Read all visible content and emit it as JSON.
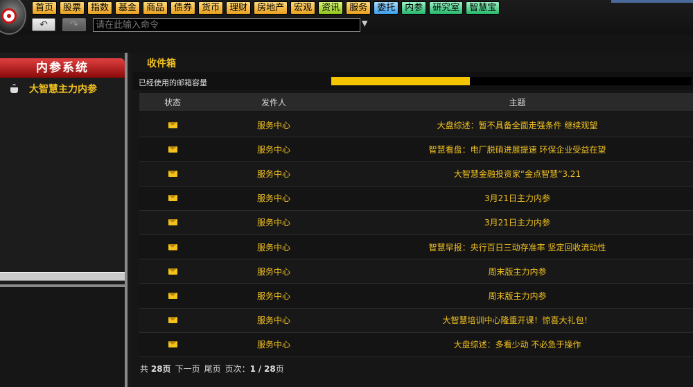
{
  "toolbar": {
    "nav": [
      {
        "label": "首页",
        "style": "orange"
      },
      {
        "label": "股票",
        "style": "orange"
      },
      {
        "label": "指数",
        "style": "orange"
      },
      {
        "label": "基金",
        "style": "orange"
      },
      {
        "label": "商品",
        "style": "orange"
      },
      {
        "label": "债券",
        "style": "orange"
      },
      {
        "label": "货币",
        "style": "orange"
      },
      {
        "label": "理财",
        "style": "orange"
      },
      {
        "label": "房地产",
        "style": "orange"
      },
      {
        "label": "宏观",
        "style": "orange"
      },
      {
        "label": "资讯",
        "style": "green"
      },
      {
        "label": "服务",
        "style": "orange"
      },
      {
        "label": "委托",
        "style": "blue"
      },
      {
        "label": "内参",
        "style": "teal"
      },
      {
        "label": "研究室",
        "style": "teal"
      },
      {
        "label": "智慧宝",
        "style": "teal"
      }
    ],
    "command_placeholder": "请在此输入命令"
  },
  "sidebar": {
    "header": "内参系统",
    "items": [
      {
        "label": "大智慧主力内参",
        "icon": "coffee-cup-icon"
      }
    ]
  },
  "main": {
    "title": "收件箱",
    "quota_label": "已经使用的邮箱容量",
    "quota_used_fraction": 0.385,
    "columns": {
      "status": "状态",
      "sender": "发件人",
      "subject": "主题"
    },
    "messages": [
      {
        "sender": "服务中心",
        "subject": "大盘综述：暂不具备全面走强条件 继续观望"
      },
      {
        "sender": "服务中心",
        "subject": "智慧看盘：电厂脱硝进展提速 环保企业受益在望"
      },
      {
        "sender": "服务中心",
        "subject": "大智慧金融投资家“金点智慧”3.21"
      },
      {
        "sender": "服务中心",
        "subject": "3月21日主力内参"
      },
      {
        "sender": "服务中心",
        "subject": "3月21日主力内参"
      },
      {
        "sender": "服务中心",
        "subject": "智慧早报：央行百日三动存准率 坚定回收流动性"
      },
      {
        "sender": "服务中心",
        "subject": "周末版主力内参"
      },
      {
        "sender": "服务中心",
        "subject": "周末版主力内参"
      },
      {
        "sender": "服务中心",
        "subject": "大智慧培训中心隆重开课！惊喜大礼包！"
      },
      {
        "sender": "服务中心",
        "subject": "大盘综述：多看少动 不必急于操作"
      }
    ],
    "pager": {
      "total_prefix": "共",
      "total": "28",
      "total_suffix": "页",
      "next": "下一页",
      "last": "尾页",
      "page_label": "页次：",
      "current": "1",
      "sep": "/",
      "pages": "28",
      "pages_suffix": "页"
    }
  }
}
